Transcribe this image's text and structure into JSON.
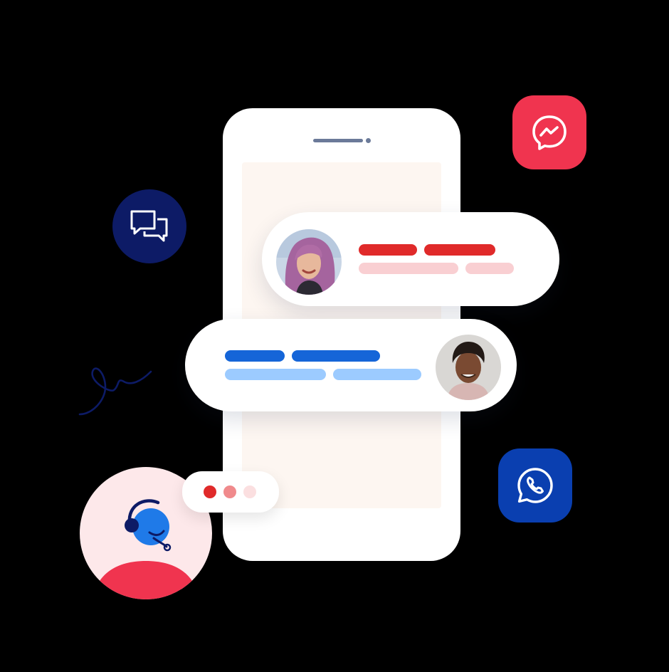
{
  "colors": {
    "background": "#000000",
    "phone_body": "#ffffff",
    "phone_screen": "#fdf6f1",
    "red_strong": "#e02a2a",
    "red_light": "#f9cfd2",
    "blue_strong": "#1565d8",
    "blue_light": "#9ccbff",
    "messenger": "#f0344f",
    "chat_navy": "#0d1b66",
    "whatsapp_blue": "#0a3fb0",
    "agent_bg": "#fde8ea"
  },
  "icons": {
    "messenger": "messenger-icon",
    "chat": "chat-bubbles-icon",
    "whatsapp": "whatsapp-icon",
    "agent": "support-agent-headset-icon",
    "squiggle": "squiggle-decoration"
  },
  "messages": [
    {
      "sender": "woman-avatar",
      "side": "left-avatar",
      "color": "red"
    },
    {
      "sender": "man-avatar",
      "side": "right-avatar",
      "color": "blue"
    }
  ],
  "typing_indicator": {
    "dots": 3
  }
}
